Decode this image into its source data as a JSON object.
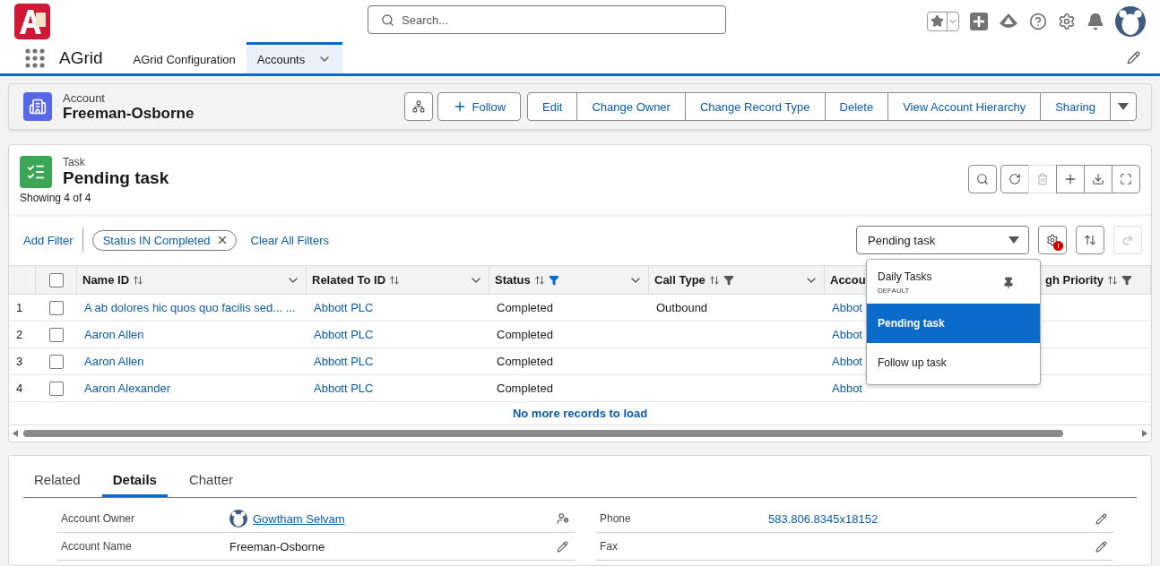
{
  "header": {
    "search": {
      "placeholder": "Search..."
    }
  },
  "nav": {
    "app_name": "AGrid",
    "tabs": [
      {
        "label": "AGrid Configuration",
        "selected": false,
        "menu": false
      },
      {
        "label": "Accounts",
        "selected": true,
        "menu": true
      }
    ]
  },
  "record": {
    "object": "Account",
    "name": "Freeman-Osborne",
    "actions": [
      "Follow",
      "Edit",
      "Change Owner",
      "Change Record Type",
      "Delete",
      "View Account Hierarchy",
      "Sharing"
    ]
  },
  "grid": {
    "object": "Task",
    "title": "Pending task",
    "count": "Showing 4 of 4",
    "add_filter": "Add Filter",
    "filter_pill": "Status IN Completed",
    "clear_filters": "Clear All Filters",
    "view_select": {
      "value": "Pending task",
      "options": [
        {
          "label": "Daily Tasks",
          "tag": "DEFAULT",
          "pinned": true,
          "selected": false
        },
        {
          "label": "Pending task",
          "selected": true
        },
        {
          "label": "Follow up task",
          "selected": false
        }
      ]
    },
    "settings_badge": "!",
    "all_checked": false,
    "columns": [
      {
        "label": "Name ID",
        "filter_icon": false,
        "filtered": false,
        "menu": true
      },
      {
        "label": "Related To ID",
        "filter_icon": false,
        "filtered": false,
        "menu": true
      },
      {
        "label": "Status",
        "filter_icon": true,
        "filtered": true,
        "menu": true
      },
      {
        "label": "Call Type",
        "filter_icon": true,
        "filtered": false,
        "menu": true
      },
      {
        "label": "Accou",
        "filter_icon": false,
        "filtered": false,
        "menu": false
      },
      {
        "label": "gh Priority",
        "filter_icon": true,
        "filtered": false,
        "menu": false
      }
    ],
    "rows": [
      {
        "num": "1",
        "checked": false,
        "cells": [
          "A ab dolores hic quos quo facilis sed... ...",
          "Abbott PLC",
          "Completed",
          "Outbound",
          "Abbot",
          ""
        ]
      },
      {
        "num": "2",
        "checked": false,
        "cells": [
          "Aaron Allen",
          "Abbott PLC",
          "Completed",
          "",
          "Abbot",
          ""
        ]
      },
      {
        "num": "3",
        "checked": false,
        "cells": [
          "Aaron Allen",
          "Abbott PLC",
          "Completed",
          "",
          "Abbot",
          ""
        ]
      },
      {
        "num": "4",
        "checked": false,
        "cells": [
          "Aaron Alexander",
          "Abbott PLC",
          "Completed",
          "",
          "Abbot",
          ""
        ]
      }
    ],
    "footer": "No more records to load"
  },
  "details": {
    "tabs": [
      {
        "label": "Related",
        "selected": false
      },
      {
        "label": "Details",
        "selected": true
      },
      {
        "label": "Chatter",
        "selected": false
      }
    ],
    "fields": [
      {
        "label": "Account Owner",
        "value": "Gowtham Selvam",
        "kind": "user"
      },
      {
        "label": "Phone",
        "value": "583.806.8345x18152",
        "kind": "link"
      },
      {
        "label": "Account Name",
        "value": "Freeman-Osborne",
        "kind": "text"
      },
      {
        "label": "Fax",
        "kind": "text"
      }
    ]
  }
}
